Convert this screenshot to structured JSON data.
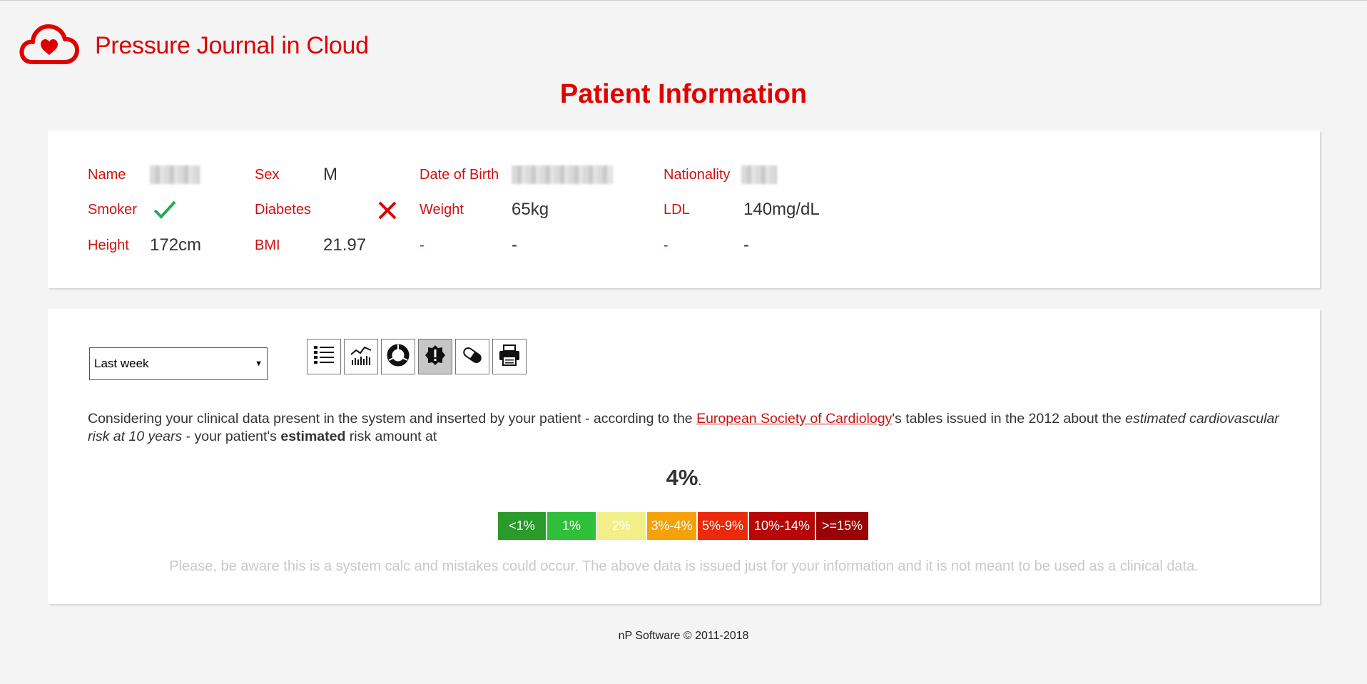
{
  "app": {
    "title": "Pressure Journal in Cloud",
    "logo_icon": "cloud-heart-icon",
    "brand_color": "#e00000"
  },
  "page": {
    "title": "Patient Information"
  },
  "patient": {
    "name_label": "Name",
    "sex_label": "Sex",
    "sex_value": "M",
    "dob_label": "Date of Birth",
    "nationality_label": "Nationality",
    "smoker_label": "Smoker",
    "smoker_value_icon": "checkmark-icon",
    "diabetes_label": "Diabetes",
    "diabetes_value_icon": "cross-icon",
    "weight_label": "Weight",
    "weight_value": "65kg",
    "ldl_label": "LDL",
    "ldl_value": "140mg/dL",
    "height_label": "Height",
    "height_value": "172cm",
    "bmi_label": "BMI",
    "bmi_value": "21.97",
    "extra1_label": "-",
    "extra1_value": "-",
    "extra2_label": "-",
    "extra2_value": "-"
  },
  "filters": {
    "period_selected": "Last week"
  },
  "toolbar": {
    "buttons": [
      {
        "icon": "list-icon",
        "active": false
      },
      {
        "icon": "chart-icon",
        "active": false
      },
      {
        "icon": "donut-icon",
        "active": false
      },
      {
        "icon": "alert-badge-icon",
        "active": true
      },
      {
        "icon": "pill-icon",
        "active": false
      },
      {
        "icon": "printer-icon",
        "active": false
      }
    ]
  },
  "risk": {
    "text_1": "Considering your clinical data present in the system and inserted by your patient - according to the ",
    "link": "European Society of Cardiology",
    "text_2": "'s tables issued in the 2012 about the ",
    "italic": "estimated cardiovascular risk at 10 years",
    "text_3": " - your patient's ",
    "bold": "estimated",
    "text_4": " risk amount at",
    "value": "4%",
    "value_suffix": ".",
    "legend": [
      {
        "label": "<1%",
        "color": "#2a9a2a"
      },
      {
        "label": "1%",
        "color": "#2fbf3a"
      },
      {
        "label": "2%",
        "color": "#f2ee8a"
      },
      {
        "label": "3%-4%",
        "color": "#f5a10a"
      },
      {
        "label": "5%-9%",
        "color": "#ea2a0a"
      },
      {
        "label": "10%-14%",
        "color": "#b80606"
      },
      {
        "label": ">=15%",
        "color": "#9a0404"
      }
    ],
    "disclaimer": "Please, be aware this is a system calc and mistakes could occur. The above data is issued just for your information and it is not meant to be used as a clinical data."
  },
  "footer": {
    "text": "nP Software © 2011-2018"
  }
}
